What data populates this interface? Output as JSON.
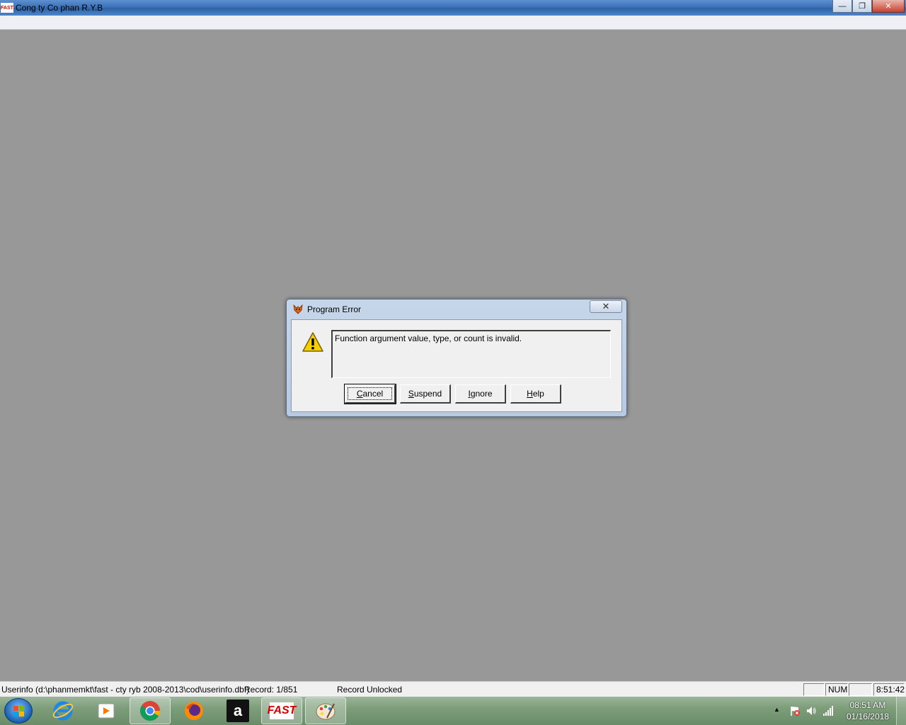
{
  "window": {
    "app_icon_text": "FAST",
    "title": "Cong ty Co phan R.Y.B",
    "minimize_glyph": "—",
    "restore_glyph": "❐",
    "close_glyph": "✕"
  },
  "dialog": {
    "title": "Program Error",
    "close_glyph": "✕",
    "message": "Function argument value, type, or count is invalid.",
    "buttons": [
      {
        "hotkey": "C",
        "rest": "ancel",
        "default": true
      },
      {
        "hotkey": "S",
        "rest": "uspend"
      },
      {
        "hotkey": "I",
        "rest": "gnore"
      },
      {
        "hotkey": "H",
        "rest": "elp"
      }
    ]
  },
  "statusbar": {
    "file": "Userinfo (d:\\phanmemkt\\fast - cty ryb 2008-2013\\cod\\userinfo.dbf)",
    "record": "Record: 1/851",
    "lock_status": "Record Unlocked",
    "num": "NUM",
    "time": "8:51:42"
  },
  "taskbar": {
    "items": [
      "internet-explorer",
      "media-player",
      "chrome",
      "firefox",
      "amazon",
      "fast",
      "paint"
    ],
    "fast_label": "FAST",
    "amazon_label": "a",
    "clock_time": "08:51 AM",
    "clock_date": "01/16/2018",
    "tray_arrow": "▲"
  }
}
